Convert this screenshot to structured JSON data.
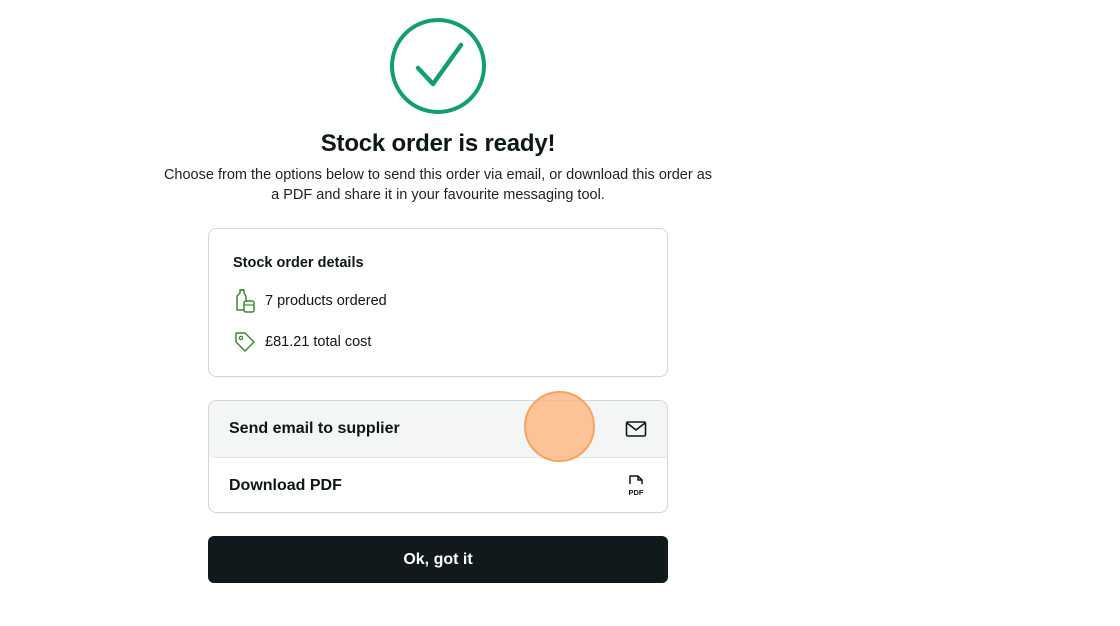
{
  "header": {
    "title": "Stock order is ready!",
    "subtitle": "Choose from the options below to send this order via email, or download this order as a PDF and share it in your favourite messaging tool."
  },
  "details": {
    "heading": "Stock order details",
    "products": "7 products ordered",
    "cost": "£81.21 total cost"
  },
  "actions": {
    "email_label": "Send email to supplier",
    "pdf_label": "Download PDF",
    "pdf_icon_text": "PDF"
  },
  "footer": {
    "ok_label": "Ok, got it"
  },
  "icons": {
    "success": "check-circle-icon",
    "products": "bottles-icon",
    "cost": "price-tag-icon",
    "email": "envelope-icon",
    "pdf": "pdf-file-icon"
  },
  "colors": {
    "success_green": "#12a06a",
    "detail_icon_green": "#3b8a2e",
    "button_dark": "#101a1d",
    "click_indicator": "#f5a35e"
  }
}
